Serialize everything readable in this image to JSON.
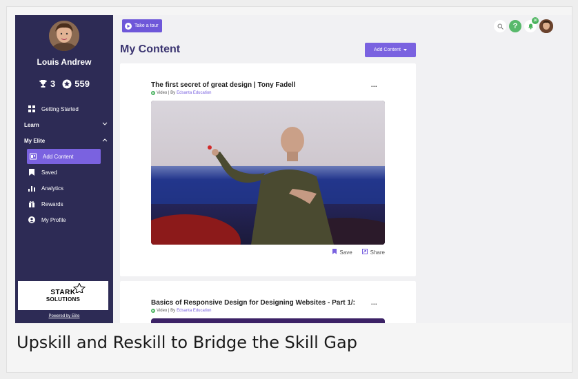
{
  "user": {
    "name": "Louis Andrew",
    "trophies": "3",
    "points": "559"
  },
  "tour_button": "Take a tour",
  "page_title": "My Content",
  "add_content_button": "Add Content",
  "notifications_count": "10",
  "sidebar": {
    "items": [
      {
        "label": "Getting Started",
        "icon": "grid-icon"
      },
      {
        "label": "Learn",
        "icon": "chevron-down-icon",
        "section": true
      },
      {
        "label": "My Elite",
        "icon": "chevron-up-icon",
        "section": true
      },
      {
        "label": "Add Content",
        "icon": "add-content-icon",
        "active": true
      },
      {
        "label": "Saved",
        "icon": "bookmark-icon"
      },
      {
        "label": "Analytics",
        "icon": "bar-chart-icon"
      },
      {
        "label": "Rewards",
        "icon": "gift-icon"
      },
      {
        "label": "My Profile",
        "icon": "account-icon"
      }
    ],
    "brand_line1": "STARK",
    "brand_line2": "SOLUTIONS",
    "powered_by": "Powered by Elite"
  },
  "cards": [
    {
      "title": "The first secret of great design | Tony Fadell",
      "meta_prefix": "Video | By",
      "source": "Edsanta Education",
      "more": "...",
      "save_label": "Save",
      "share_label": "Share"
    },
    {
      "title": "Basics of Responsive Design for Designing Websites - Part 1/:",
      "meta_prefix": "Video | By",
      "source": "Edsanta Education",
      "more": "..."
    }
  ],
  "caption": "Upskill and Reskill to Bridge the Skill Gap",
  "colors": {
    "sidebar": "#2d2b55",
    "accent": "#7a62e0",
    "title": "#3a3470",
    "green": "#4bb361"
  }
}
